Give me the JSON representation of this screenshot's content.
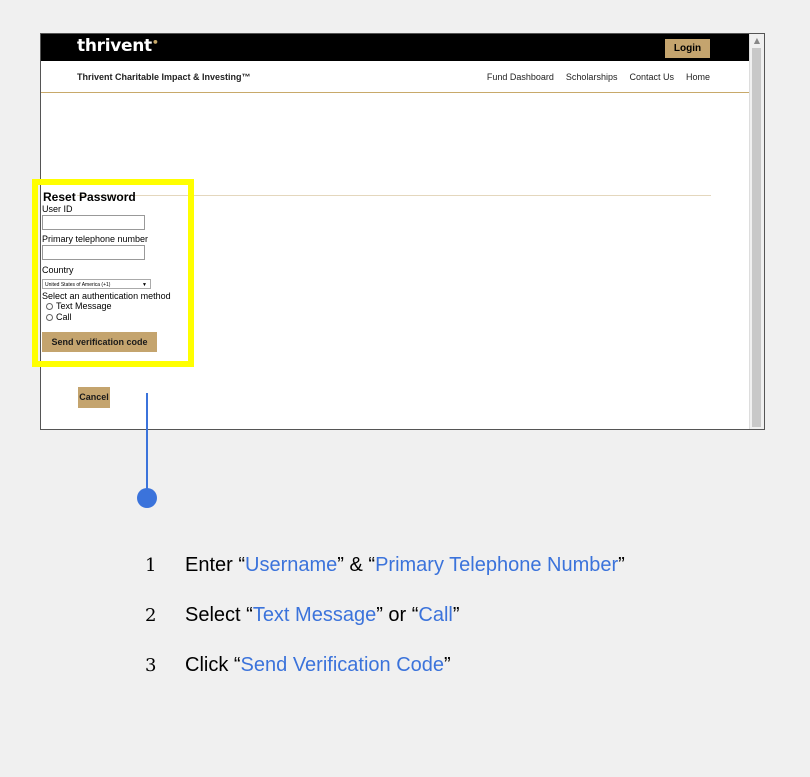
{
  "app": {
    "logo": "thrivent",
    "logo_mark": "•",
    "login_label": "Login",
    "site_name": "Thrivent Charitable Impact & Investing™",
    "nav_links": [
      "Fund Dashboard",
      "Scholarships",
      "Contact Us",
      "Home"
    ]
  },
  "form": {
    "title": "Reset Password",
    "user_id_label": "User ID",
    "user_id_value": "",
    "phone_label": "Primary telephone number",
    "phone_value": "",
    "country_label": "Country",
    "country_selected": "United States of America (+1)",
    "auth_label": "Select an authentication method",
    "auth_options": [
      "Text Message",
      "Call"
    ],
    "send_label": "Send verification code",
    "cancel_label": "Cancel"
  },
  "instructions": {
    "steps": [
      {
        "num": "1",
        "prefix": "Enter “",
        "hl1": "Username",
        "mid": "” & “",
        "hl2": "Primary Telephone Number",
        "suffix": "”"
      },
      {
        "num": "2",
        "prefix": "Select “",
        "hl1": "Text Message",
        "mid": "” or “",
        "hl2": "Call",
        "suffix": "”"
      },
      {
        "num": "3",
        "prefix": "Click “",
        "hl1": "Send Verification Code",
        "suffix": "”"
      }
    ]
  },
  "colors": {
    "brand_gold": "#c4a46e",
    "highlight_yellow": "#ffff00",
    "annotation_blue": "#3b73db"
  }
}
